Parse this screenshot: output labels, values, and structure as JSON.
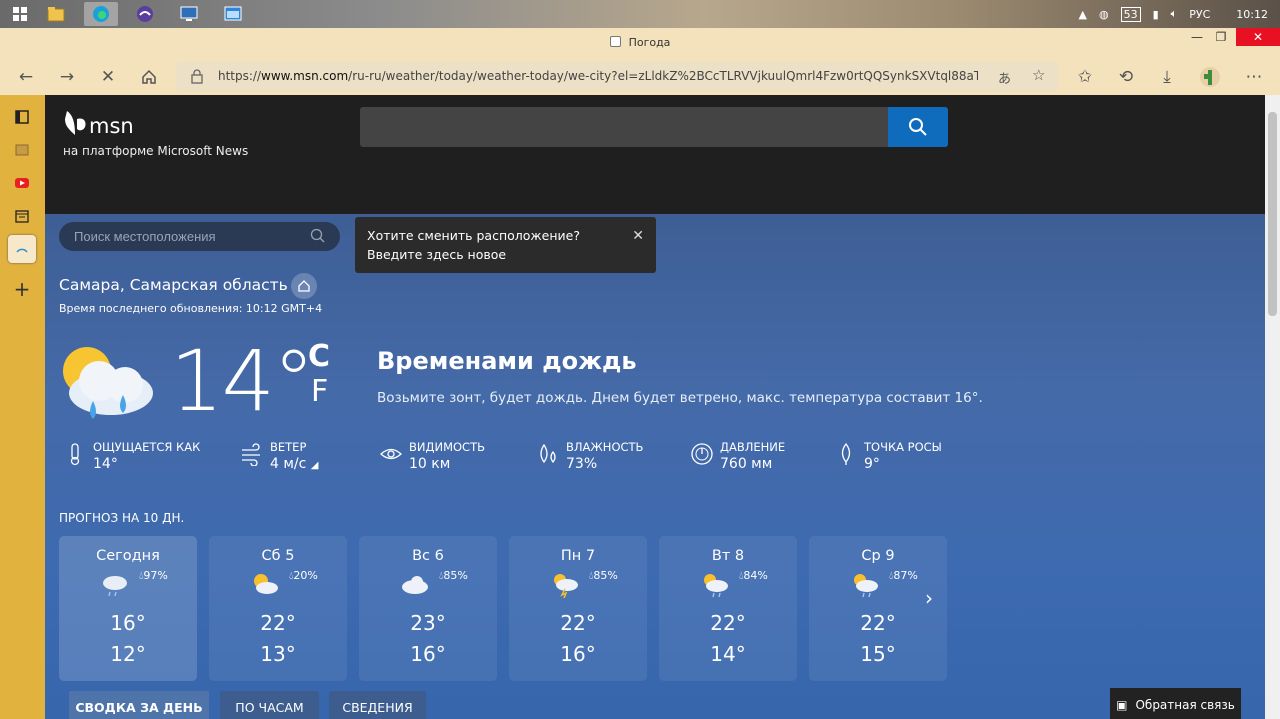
{
  "taskbar": {
    "tray": {
      "lang": "РУС",
      "time": "10:12",
      "badge": "53"
    }
  },
  "window": {
    "title": "Погода"
  },
  "address": {
    "url_prefix": "https://",
    "url_domain": "www.msn.com",
    "url_rest": "/ru-ru/weather/today/weather-today/we-city?el=zLldkZ%2BCcTLRVVjkuulQmrl4Fzw0rtQQSynkSXVtql88aT%..."
  },
  "msn": {
    "logo": "msn",
    "subtitle": "на платформе Microsoft News",
    "search_value": ""
  },
  "location_search": {
    "placeholder": "Поиск местоположения"
  },
  "tooltip": {
    "text": "Хотите сменить расположение? Введите здесь новое"
  },
  "current": {
    "city": "Самара, Самарская область",
    "updated": "Время последнего обновления: 10:12 GMT+4",
    "temp": "14°",
    "unit_c": "C",
    "unit_f": "F",
    "condition": "Временами дождь",
    "description": "Возьмите зонт, будет дождь. Днем будет ветрено, макс. температура составит 16°."
  },
  "metrics": [
    {
      "label": "ОЩУЩАЕТСЯ КАК",
      "value": "14°",
      "icon": "thermometer-icon"
    },
    {
      "label": "ВЕТЕР",
      "value": "4 м/с",
      "icon": "wind-icon"
    },
    {
      "label": "ВИДИМОСТЬ",
      "value": "10 км",
      "icon": "eye-icon"
    },
    {
      "label": "ВЛАЖНОСТЬ",
      "value": "73%",
      "icon": "humidity-icon"
    },
    {
      "label": "ДАВЛЕНИЕ",
      "value": "760 мм",
      "icon": "pressure-icon"
    },
    {
      "label": "ТОЧКА РОСЫ",
      "value": "9°",
      "icon": "dewpoint-icon"
    }
  ],
  "forecast": {
    "title": "ПРОГНОЗ НА 10 ДН.",
    "days": [
      {
        "name": "Сегодня",
        "precip": "97%",
        "hi": "16°",
        "lo": "12°",
        "icon": "rain-cloud-icon"
      },
      {
        "name": "Сб 5",
        "precip": "20%",
        "hi": "22°",
        "lo": "13°",
        "icon": "partly-cloudy-icon"
      },
      {
        "name": "Вс 6",
        "precip": "85%",
        "hi": "23°",
        "lo": "16°",
        "icon": "cloudy-icon"
      },
      {
        "name": "Пн 7",
        "precip": "85%",
        "hi": "22°",
        "lo": "16°",
        "icon": "thunder-icon"
      },
      {
        "name": "Вт 8",
        "precip": "84%",
        "hi": "22°",
        "lo": "14°",
        "icon": "sun-rain-icon"
      },
      {
        "name": "Ср 9",
        "precip": "87%",
        "hi": "22°",
        "lo": "15°",
        "icon": "sun-rain-icon"
      }
    ]
  },
  "tabs": [
    "СВОДКА ЗА ДЕНЬ",
    "ПО ЧАСАМ",
    "СВЕДЕНИЯ"
  ],
  "feedback": "Обратная связь",
  "colors": {
    "accent": "#0f6cbd",
    "sidebar": "#e1b23e",
    "chrome": "#f4e2bd"
  }
}
